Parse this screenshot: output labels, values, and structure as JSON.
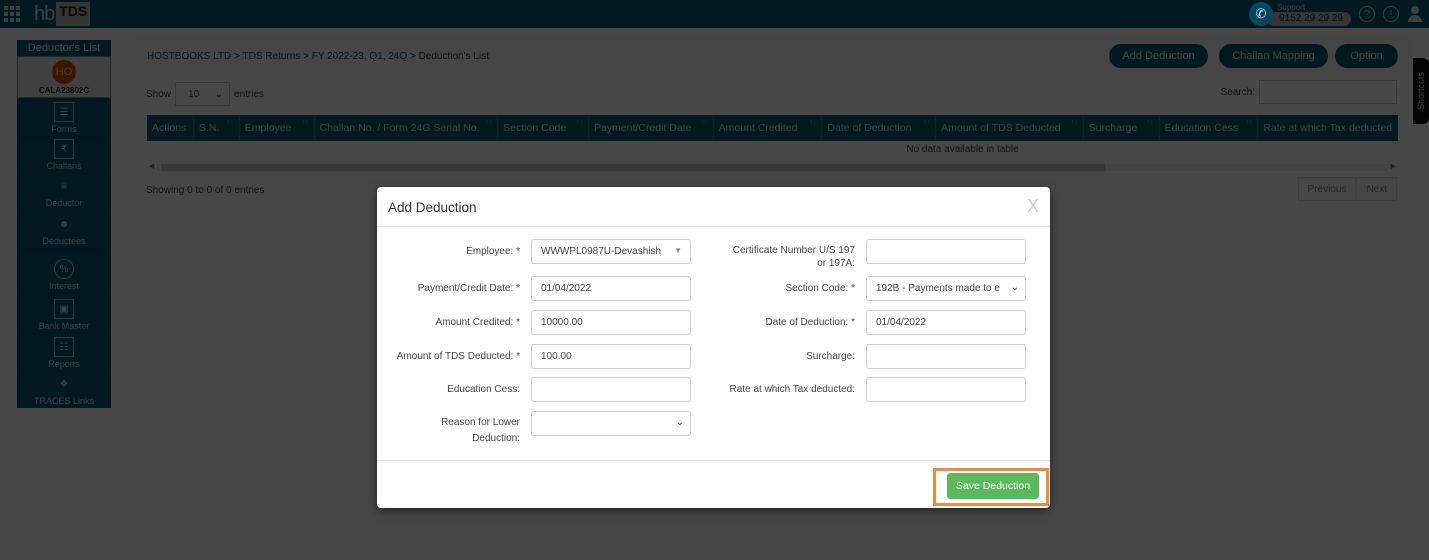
{
  "topbar": {
    "logo_hb": "hb",
    "logo_tds": "TDS",
    "support_label": "Support",
    "support_number": "9152 29 29 29",
    "icons": [
      "apps-grid-icon",
      "phone-icon",
      "help-icon",
      "info-icon",
      "user-icon"
    ]
  },
  "sidebar": {
    "title": "Deductor's List",
    "avatar_initials": "HO",
    "deductor_code": "CALA23802C",
    "items": [
      {
        "label": "Forms",
        "icon": "forms-icon"
      },
      {
        "label": "Challans",
        "icon": "challans-icon"
      },
      {
        "label": "Deductor",
        "icon": "deductor-icon"
      },
      {
        "label": "Deductees",
        "icon": "deductees-icon"
      },
      {
        "label": "Interest",
        "icon": "interest-icon"
      },
      {
        "label": "Bank Master",
        "icon": "bank-master-icon"
      },
      {
        "label": "Reports",
        "icon": "reports-icon"
      },
      {
        "label": "TRACES Links",
        "icon": "traces-icon"
      }
    ]
  },
  "header": {
    "breadcrumb": [
      "HOSTBOOKS LTD",
      "TDS Returns",
      "FY 2022-23, Q1, 24Q",
      "Deduction's List"
    ],
    "separator": ">",
    "buttons": {
      "add_deduction": "Add Deduction",
      "challan_mapping": "Challan Mapping",
      "option": "Option"
    }
  },
  "table": {
    "show_label": "Show",
    "entries_value": "10",
    "entries_label": "entries",
    "search_label": "Search:",
    "search_value": "",
    "columns": [
      "Actions",
      "S.N.",
      "Employee",
      "Challan No. / Form 24G Serial No.",
      "Section Code",
      "Payment/Credit Date",
      "Amount Credited",
      "Date of Deduction",
      "Amount of TDS Deducted",
      "Surcharge",
      "Education Cess",
      "Rate at which Tax deducted"
    ],
    "empty_message": "No data available in table",
    "info": "Showing 0 to 0 of 0 entries",
    "pager": {
      "previous": "Previous",
      "next": "Next"
    },
    "shortcuts_tab": "Shortcuts"
  },
  "modal": {
    "title": "Add Deduction",
    "close": "X",
    "fields": {
      "employee": {
        "label": "Employee: *",
        "value": "WWWPL0987U-Devashish"
      },
      "payment_date": {
        "label": "Payment/Credit Date: *",
        "value": "01/04/2022"
      },
      "amount_credited": {
        "label": "Amount Credited: *",
        "value": "10000.00"
      },
      "tds_deducted": {
        "label": "Amount of TDS Deducted: *",
        "value": "100.00"
      },
      "education_cess": {
        "label": "Education Cess:",
        "value": ""
      },
      "reason_lower": {
        "label_1": "Reason for Lower",
        "label_2": "Deduction:",
        "value": ""
      },
      "certificate": {
        "label_1": "Certificate Number U/S 197",
        "label_2": "or 197A:",
        "value": ""
      },
      "section_code": {
        "label": "Section Code: *",
        "value": "192B - Payments made to e"
      },
      "date_deduction": {
        "label": "Date of Deduction: *",
        "value": "01/04/2022"
      },
      "surcharge": {
        "label": "Surcharge:",
        "value": ""
      },
      "rate": {
        "label": "Rate at which Tax deducted:",
        "value": ""
      }
    },
    "save_button": "Save Deduction"
  }
}
